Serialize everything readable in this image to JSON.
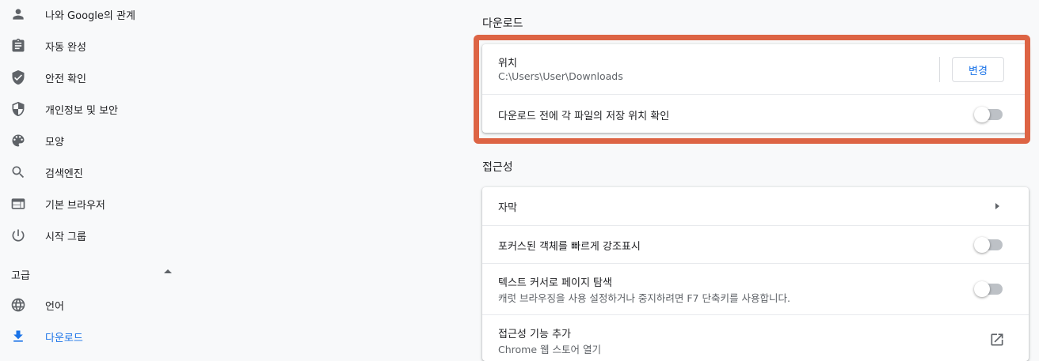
{
  "sidebar": {
    "items": [
      {
        "label": "나와 Google의 관계",
        "icon": "person-icon"
      },
      {
        "label": "자동 완성",
        "icon": "clipboard-icon"
      },
      {
        "label": "안전 확인",
        "icon": "shield-check-icon"
      },
      {
        "label": "개인정보 및 보안",
        "icon": "shield-icon"
      },
      {
        "label": "모양",
        "icon": "palette-icon"
      },
      {
        "label": "검색엔진",
        "icon": "search-icon"
      },
      {
        "label": "기본 브라우저",
        "icon": "browser-icon"
      },
      {
        "label": "시작 그룹",
        "icon": "power-icon"
      }
    ],
    "advanced_label": "고급",
    "advanced_items": [
      {
        "label": "언어",
        "icon": "globe-icon"
      },
      {
        "label": "다운로드",
        "icon": "download-icon",
        "active": true
      }
    ]
  },
  "downloads": {
    "title": "다운로드",
    "location_label": "위치",
    "location_path": "C:\\Users\\User\\Downloads",
    "change_button": "변경",
    "ask_label": "다운로드 전에 각 파일의 저장 위치 확인",
    "ask_enabled": false
  },
  "accessibility": {
    "title": "접근성",
    "captions_label": "자막",
    "focus_label": "포커스된 객체를 빠르게 강조표시",
    "focus_enabled": false,
    "caret_label": "텍스트 커서로 페이지 탐색",
    "caret_sub": "캐럿 브라우징을 사용 설정하거나 중지하려면 F7 단축키를 사용합니다.",
    "caret_enabled": false,
    "more_label": "접근성 기능 추가",
    "more_sub": "Chrome 웹 스토어 열기"
  },
  "colors": {
    "accent": "#1a73e8",
    "highlight": "#dd6444"
  }
}
